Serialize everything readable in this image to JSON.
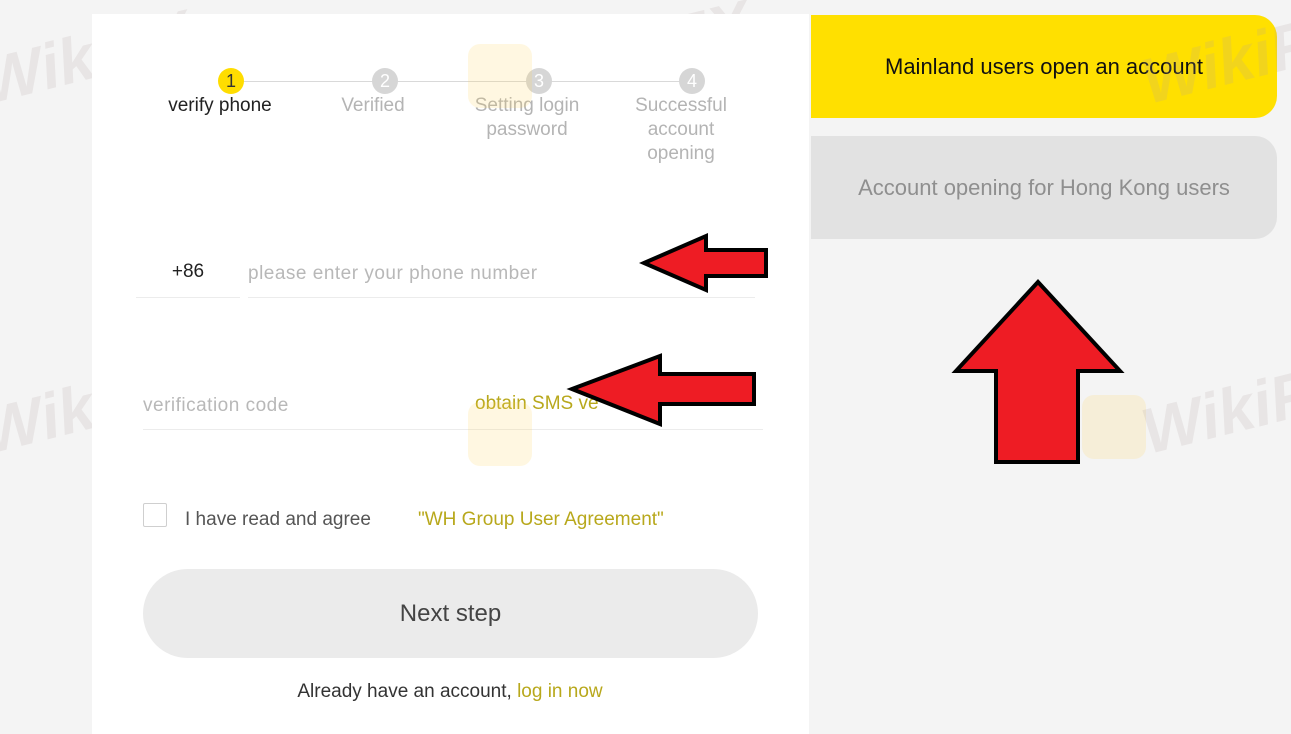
{
  "steps": [
    {
      "number": "1",
      "label": "verify phone",
      "state": "active"
    },
    {
      "number": "2",
      "label": "Verified",
      "state": "inactive"
    },
    {
      "number": "3",
      "label": "Setting login\npassword",
      "state": "inactive"
    },
    {
      "number": "4",
      "label": "Successful\naccount\nopening",
      "state": "inactive"
    }
  ],
  "phone": {
    "country_code": "+86",
    "placeholder": "please enter your phone number",
    "value": ""
  },
  "verification": {
    "placeholder": "verification code",
    "value": "",
    "obtain_sms_label": "obtain SMS ve"
  },
  "agreement": {
    "checked": false,
    "text": "I have read and agree",
    "link": "\"WH Group User Agreement\""
  },
  "next_button_label": "Next step",
  "login": {
    "prefix": "Already have an account,",
    "link": "log in now"
  },
  "tabs": [
    {
      "label": "Mainland users open an account",
      "selected": true
    },
    {
      "label": "Account opening for Hong Kong users",
      "selected": false
    }
  ],
  "colors": {
    "accent": "#ffdd00",
    "link": "#b8a81c",
    "arrow": "#ee1c24"
  },
  "watermark_text": "WikiFX"
}
